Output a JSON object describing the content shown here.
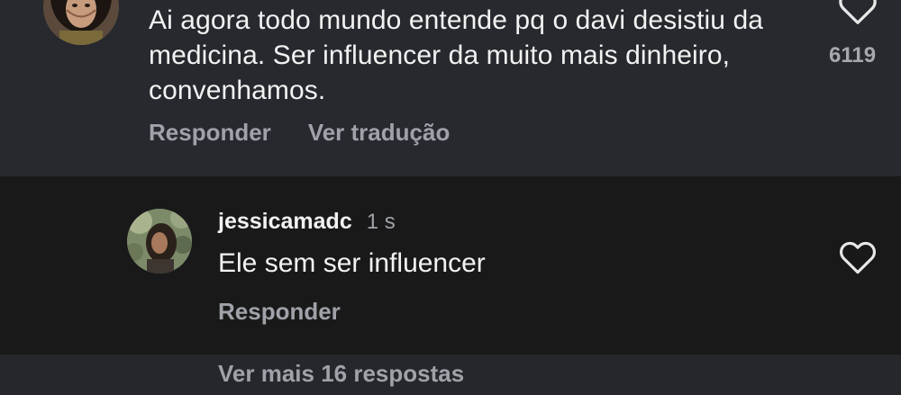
{
  "comment": {
    "text": "Ai agora todo mundo entende pq o davi desistiu da medicina. Ser influencer da muito mais dinheiro, convenhamos.",
    "like_count": "6119",
    "actions": {
      "reply": "Responder",
      "translate": "Ver tradução"
    },
    "icons": {
      "like": "heart-outline-icon",
      "avatar": "user-avatar"
    }
  },
  "reply": {
    "username": "jessicamadc",
    "time": "1 s",
    "text": "Ele sem ser influencer",
    "actions": {
      "reply": "Responder"
    },
    "icons": {
      "like": "heart-outline-icon",
      "avatar": "user-avatar"
    }
  },
  "more_replies": {
    "label": "Ver mais 16 respostas"
  },
  "colors": {
    "comment_bg": "#27292e",
    "reply_bg": "#19191a",
    "more_bg": "#25272b",
    "text_primary": "#f2f2f2",
    "text_secondary": "#9fa2a8"
  }
}
